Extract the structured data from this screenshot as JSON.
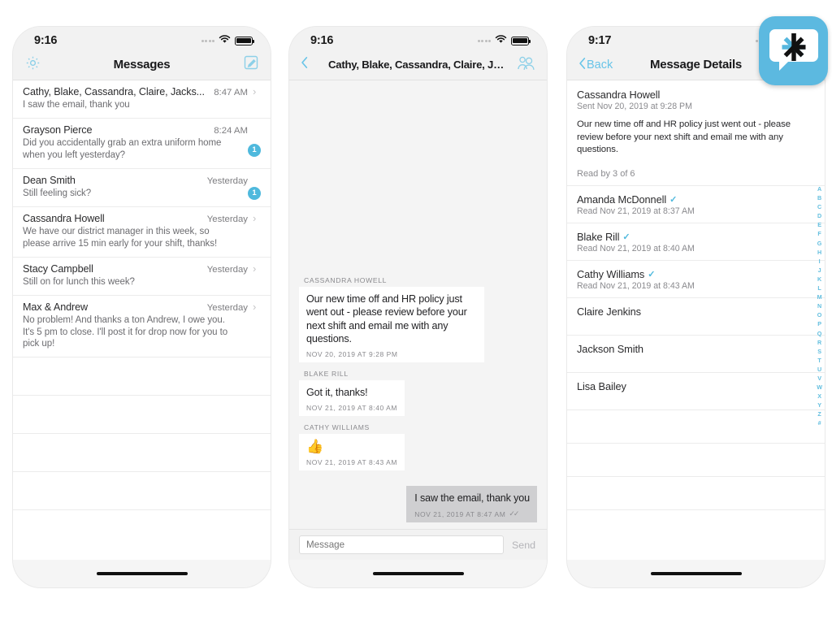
{
  "app_icon": {
    "name": "messaging-app-icon",
    "bg_color": "#5cb9e0"
  },
  "accent_color": "#4fb9dd",
  "phone1": {
    "status": {
      "time": "9:16"
    },
    "nav": {
      "title": "Messages",
      "left_icon": "gear-icon",
      "right_icon": "compose-icon"
    },
    "conversations": [
      {
        "name": "Cathy, Blake, Cassandra, Claire, Jacks...",
        "time": "8:47 AM",
        "preview": "I saw the email, thank you",
        "badge": "",
        "chevron": true
      },
      {
        "name": "Grayson Pierce",
        "time": "8:24 AM",
        "preview": "Did you accidentally grab an extra uniform home when you left yesterday?",
        "badge": "1",
        "chevron": false
      },
      {
        "name": "Dean  Smith",
        "time": "Yesterday",
        "preview": "Still feeling sick?",
        "badge": "1",
        "chevron": false
      },
      {
        "name": "Cassandra Howell",
        "time": "Yesterday",
        "preview": "We have our district manager in this week, so please arrive 15 min early for your shift, thanks!",
        "badge": "",
        "chevron": true
      },
      {
        "name": "Stacy Campbell",
        "time": "Yesterday",
        "preview": "Still on for lunch this week?",
        "badge": "",
        "chevron": true
      },
      {
        "name": "Max & Andrew",
        "time": "Yesterday",
        "preview": "No problem! And thanks a ton Andrew, I owe you. It's 5 pm to close. I'll post it for drop now for you to pick up!",
        "badge": "",
        "chevron": true
      }
    ]
  },
  "phone2": {
    "status": {
      "time": "9:16"
    },
    "nav": {
      "title": "Cathy, Blake, Cassandra, Claire, Jac...",
      "left_icon": "back-chevron-icon",
      "right_icon": "group-members-icon"
    },
    "messages": [
      {
        "sender": "CASSANDRA HOWELL",
        "text": "Our new time off and HR policy just went out - please review before your next shift and email me with any questions.",
        "time": "NOV 20, 2019 AT 9:28 PM",
        "outgoing": false,
        "emoji": false
      },
      {
        "sender": "BLAKE RILL",
        "text": "Got it, thanks!",
        "time": "NOV 21, 2019 AT 8:40 AM",
        "outgoing": false,
        "emoji": false
      },
      {
        "sender": "CATHY WILLIAMS",
        "text": "👍",
        "time": "NOV 21, 2019 AT 8:43 AM",
        "outgoing": false,
        "emoji": true
      },
      {
        "sender": "",
        "text": "I saw the email, thank you",
        "time": "NOV 21, 2019 AT 8:47 AM",
        "outgoing": true,
        "emoji": false,
        "read_ticks": "✓✓"
      }
    ],
    "composer": {
      "placeholder": "Message",
      "value": "",
      "send_label": "Send"
    }
  },
  "phone3": {
    "status": {
      "time": "9:17"
    },
    "nav": {
      "back_label": "Back",
      "title": "Message Details"
    },
    "detail": {
      "sender": "Cassandra Howell",
      "sent": "Sent Nov 20, 2019 at 9:28 PM",
      "body": "Our new time off and HR policy just went out - please review before your next shift and email me with any questions.",
      "read_by": "Read by 3 of 6"
    },
    "recipients": [
      {
        "name": "Amanda McDonnell",
        "check": "✓",
        "status": "Read Nov 21, 2019 at 8:37 AM"
      },
      {
        "name": "Blake Rill",
        "check": "✓",
        "status": "Read Nov 21, 2019 at 8:40 AM"
      },
      {
        "name": "Cathy Williams",
        "check": "✓",
        "status": "Read Nov 21, 2019 at 8:43 AM"
      },
      {
        "name": "Claire Jenkins",
        "check": "",
        "status": ""
      },
      {
        "name": "Jackson  Smith",
        "check": "",
        "status": ""
      },
      {
        "name": "Lisa Bailey",
        "check": "",
        "status": ""
      }
    ],
    "alpha_index": [
      "A",
      "B",
      "C",
      "D",
      "E",
      "F",
      "G",
      "H",
      "I",
      "J",
      "K",
      "L",
      "M",
      "N",
      "O",
      "P",
      "Q",
      "R",
      "S",
      "T",
      "U",
      "V",
      "W",
      "X",
      "Y",
      "Z",
      "#"
    ]
  }
}
